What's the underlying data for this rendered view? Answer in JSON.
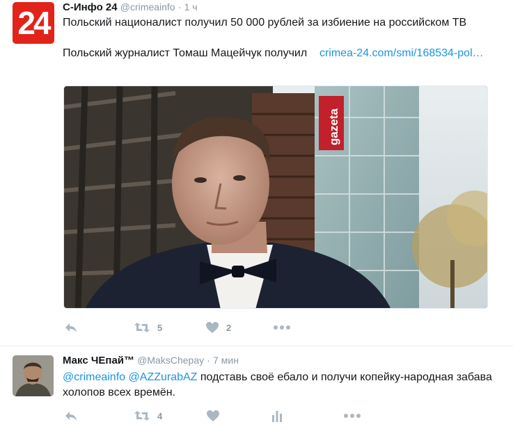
{
  "tweets": [
    {
      "avatar_text": "24",
      "fullname": "С-Инфо 24",
      "handle": "@crimeainfo",
      "dot": "·",
      "time": "1 ч",
      "text_line1": "Польский националист получил 50 000 рублей за избиение на российском ТВ",
      "text_line2": "Польский журналист Томаш Мацейчук получил",
      "link": "crimea-24.com/smi/168534-pol…",
      "media_sign": "gazeta",
      "retweets": "5",
      "likes": "2"
    },
    {
      "fullname": "Макс ЧЕпай™",
      "handle": "@MaksChepay",
      "dot": "·",
      "time": "7 мин",
      "mention1": "@crimeainfo",
      "mention2": "@AZZurabAZ",
      "text": " подставь своё ебало и получи копейку-народная забава холопов всех времён.",
      "retweets": "4"
    }
  ],
  "colors": {
    "link": "#1b95e0",
    "muted": "#8899a6",
    "brand_red": "#e2231a"
  },
  "icons": [
    "reply-icon",
    "retweet-icon",
    "like-icon",
    "more-icon",
    "analytics-icon"
  ]
}
